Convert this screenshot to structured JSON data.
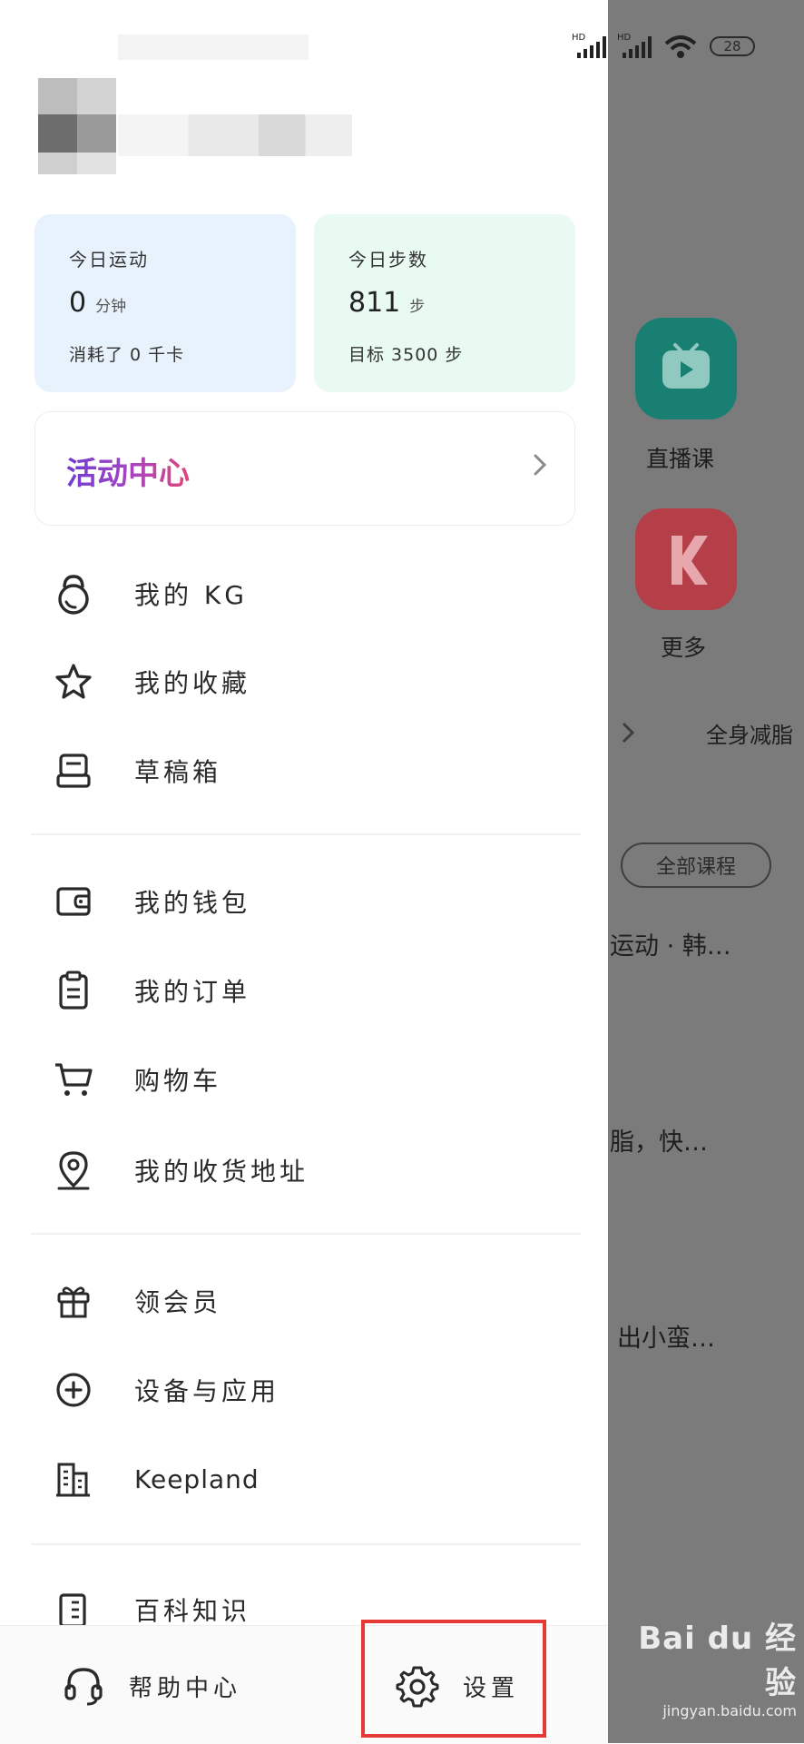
{
  "status_bar": {
    "battery": "28"
  },
  "stats": {
    "exercise": {
      "label": "今日运动",
      "value": "0",
      "unit": "分钟",
      "sub": "消耗了 0 千卡"
    },
    "steps": {
      "label": "今日步数",
      "value": "811",
      "unit": "步",
      "sub": "目标 3500 步"
    }
  },
  "activity_center": {
    "title": "活动中心"
  },
  "menu": {
    "group1": [
      {
        "icon": "kettlebell-icon",
        "label": "我的 KG"
      },
      {
        "icon": "star-icon",
        "label": "我的收藏"
      },
      {
        "icon": "drafts-icon",
        "label": "草稿箱"
      }
    ],
    "group2": [
      {
        "icon": "wallet-icon",
        "label": "我的钱包"
      },
      {
        "icon": "clipboard-icon",
        "label": "我的订单"
      },
      {
        "icon": "cart-icon",
        "label": "购物车"
      },
      {
        "icon": "location-pin-icon",
        "label": "我的收货地址"
      }
    ],
    "group3": [
      {
        "icon": "gift-icon",
        "label": "领会员"
      },
      {
        "icon": "plus-circle-icon",
        "label": "设备与应用"
      },
      {
        "icon": "buildings-icon",
        "label": "Keepland"
      }
    ],
    "group4": [
      {
        "icon": "book-icon",
        "label": "百科知识"
      }
    ]
  },
  "bottom_bar": {
    "help": {
      "icon": "headset-icon",
      "label": "帮助中心"
    },
    "settings": {
      "icon": "gear-icon",
      "label": "设置"
    }
  },
  "background_app": {
    "tiles": [
      {
        "icon": "tv-play-icon",
        "label": "直播课",
        "color": "#1a7f73"
      },
      {
        "icon": "k-logo-icon",
        "label": "更多",
        "color": "#b53f48"
      }
    ],
    "row_text": "全身减脂",
    "all_courses": "全部课程",
    "course_snippets": [
      "运动 · 韩…",
      "脂，快…",
      "出小蛮…"
    ]
  },
  "watermark": {
    "brand": "Bai du 经验",
    "url": "jingyan.baidu.com"
  }
}
